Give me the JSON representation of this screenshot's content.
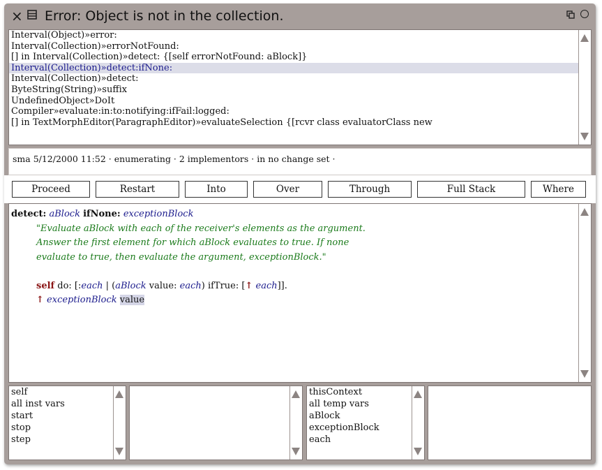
{
  "window": {
    "title": "Error: Object is not in the collection.",
    "icons": [
      "close-icon",
      "window-menu-icon",
      "collapse-icon",
      "expand-icon"
    ]
  },
  "stack": {
    "lines": [
      "Interval(Object)»error:",
      "Interval(Collection)»errorNotFound:",
      "[] in Interval(Collection)»detect: {[self errorNotFound: aBlock]}",
      "Interval(Collection)»detect:ifNone:",
      "Interval(Collection)»detect:",
      "ByteString(String)»suffix",
      "UndefinedObject»DoIt",
      "Compiler»evaluate:in:to:notifying:ifFail:logged:",
      "[] in TextMorphEditor(ParagraphEditor)»evaluateSelection {[rcvr class evaluatorClass new"
    ],
    "selected_index": 3
  },
  "annotation": "sma 5/12/2000 11:52 · enumerating · 2 implementors · in no change set ·",
  "buttons": [
    "Proceed",
    "Restart",
    "Into",
    "Over",
    "Through",
    "Full Stack",
    "Where"
  ],
  "code": {
    "selector_kw1": "detect:",
    "arg1": "aBlock",
    "selector_kw2": "ifNone:",
    "arg2": "exceptionBlock",
    "comment_lines": [
      "\"Evaluate aBlock with each of the receiver's elements as the argument.",
      "Answer the first element for which aBlock evaluates to true. If none",
      "evaluate to true, then evaluate the argument, exceptionBlock.\""
    ],
    "line1": {
      "self": "self",
      "do": " do: [:",
      "each1": "each",
      "bar": " | (",
      "ablock": "aBlock",
      "value": " value: ",
      "each2": "each",
      "iftrue": ") ifTrue: [",
      "caret": "↑",
      "each3": "each",
      "end": "]]."
    },
    "line2": {
      "caret": "↑",
      "exception": "exceptionBlock",
      "value": "value"
    }
  },
  "receiver_inspector": {
    "items": [
      "self",
      "all inst vars",
      "start",
      "stop",
      "step"
    ]
  },
  "context_inspector": {
    "items": [
      "thisContext",
      "all temp vars",
      "aBlock",
      "exceptionBlock",
      "each"
    ]
  }
}
